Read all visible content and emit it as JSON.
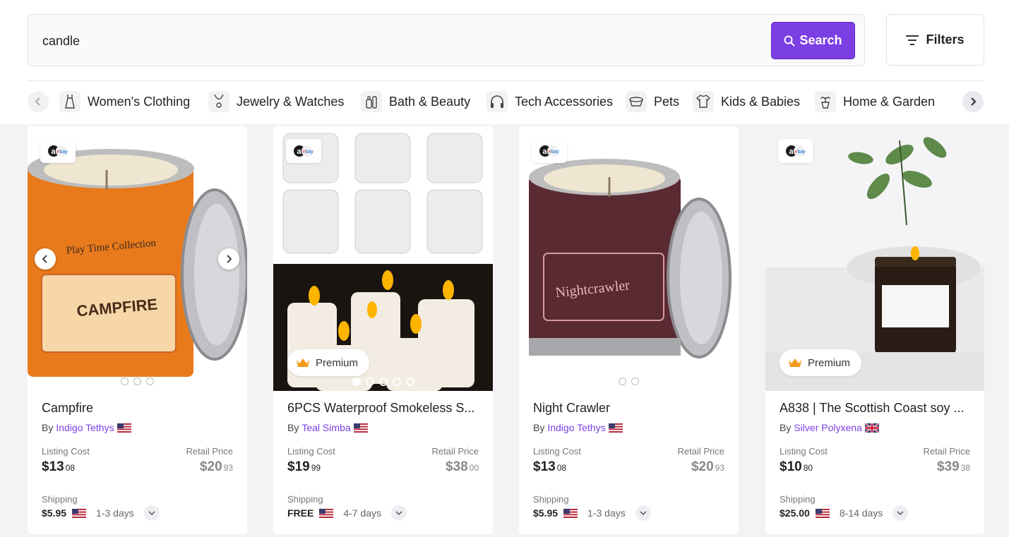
{
  "search": {
    "query": "candle",
    "button_label": "Search"
  },
  "filters_label": "Filters",
  "categories": [
    {
      "label": "Women's Clothing",
      "icon": "dress-icon"
    },
    {
      "label": "Jewelry & Watches",
      "icon": "necklace-icon"
    },
    {
      "label": "Bath & Beauty",
      "icon": "beauty-bottle-icon"
    },
    {
      "label": "Tech Accessories",
      "icon": "headphones-icon"
    },
    {
      "label": "Pets",
      "icon": "pet-bowl-icon"
    },
    {
      "label": "Kids & Babies",
      "icon": "baby-onesie-icon"
    },
    {
      "label": "Home & Garden",
      "icon": "potted-plant-icon"
    }
  ],
  "products": [
    {
      "title": "Campfire",
      "by": "By",
      "supplier": "Indigo Tethys",
      "supplier_flag": "US",
      "listing_label": "Listing Cost",
      "listing_dollars": "$13",
      "listing_cents": "08",
      "retail_label": "Retail Price",
      "retail_dollars": "$20",
      "retail_cents": "93",
      "shipping_label": "Shipping",
      "shipping_cost": "$5.95",
      "shipping_days": "1-3 days",
      "image_count": 3
    },
    {
      "title": "6PCS Waterproof Smokeless S...",
      "by": "By",
      "supplier": "Teal Simba",
      "supplier_flag": "US",
      "premium_label": "Premium",
      "listing_label": "Listing Cost",
      "listing_dollars": "$19",
      "listing_cents": "99",
      "retail_label": "Retail Price",
      "retail_dollars": "$38",
      "retail_cents": "00",
      "shipping_label": "Shipping",
      "shipping_cost": "FREE",
      "shipping_days": "4-7 days",
      "image_count": 5
    },
    {
      "title": "Night Crawler",
      "by": "By",
      "supplier": "Indigo Tethys",
      "supplier_flag": "US",
      "listing_label": "Listing Cost",
      "listing_dollars": "$13",
      "listing_cents": "08",
      "retail_label": "Retail Price",
      "retail_dollars": "$20",
      "retail_cents": "93",
      "shipping_label": "Shipping",
      "shipping_cost": "$5.95",
      "shipping_days": "1-3 days",
      "image_count": 2
    },
    {
      "title": "A838 | The Scottish Coast soy ...",
      "by": "By",
      "supplier": "Silver Polyxena",
      "supplier_flag": "GB",
      "premium_label": "Premium",
      "listing_label": "Listing Cost",
      "listing_dollars": "$10",
      "listing_cents": "80",
      "retail_label": "Retail Price",
      "retail_dollars": "$39",
      "retail_cents": "38",
      "shipping_label": "Shipping",
      "shipping_cost": "$25.00",
      "shipping_days": "8-14 days",
      "image_count": 1
    }
  ],
  "colors": {
    "accent": "#7b3fe4",
    "background": "#f3f3f5"
  }
}
